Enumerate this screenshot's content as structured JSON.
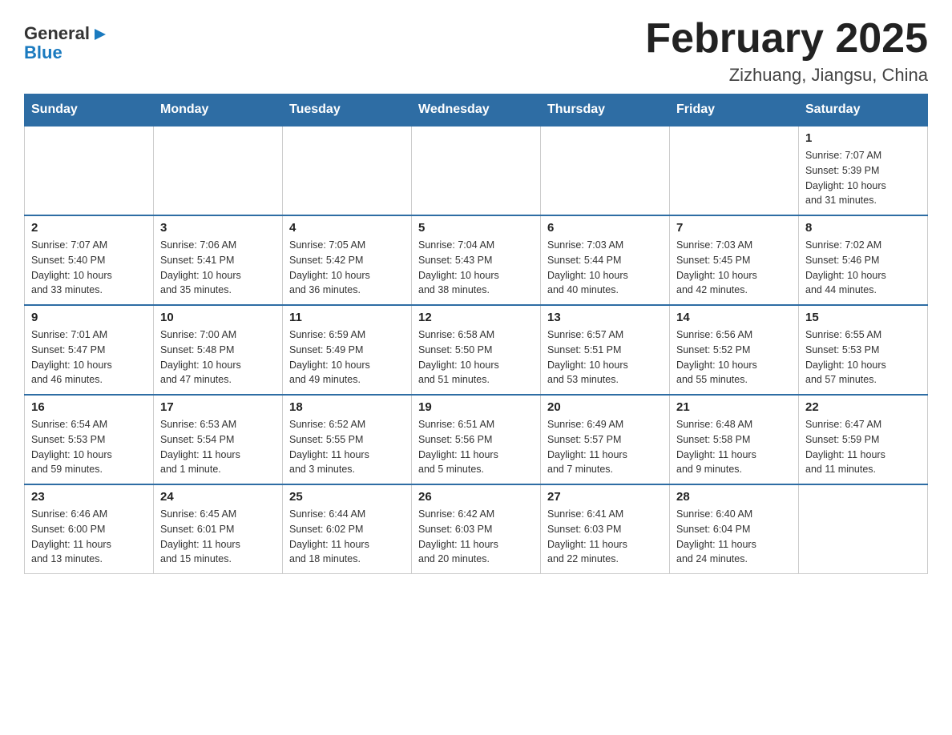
{
  "header": {
    "logo": {
      "text1": "General",
      "arrow": "▶",
      "text2": "Blue"
    },
    "title": "February 2025",
    "subtitle": "Zizhuang, Jiangsu, China"
  },
  "days_of_week": [
    "Sunday",
    "Monday",
    "Tuesday",
    "Wednesday",
    "Thursday",
    "Friday",
    "Saturday"
  ],
  "weeks": [
    {
      "days": [
        {
          "num": "",
          "info": ""
        },
        {
          "num": "",
          "info": ""
        },
        {
          "num": "",
          "info": ""
        },
        {
          "num": "",
          "info": ""
        },
        {
          "num": "",
          "info": ""
        },
        {
          "num": "",
          "info": ""
        },
        {
          "num": "1",
          "info": "Sunrise: 7:07 AM\nSunset: 5:39 PM\nDaylight: 10 hours\nand 31 minutes."
        }
      ]
    },
    {
      "days": [
        {
          "num": "2",
          "info": "Sunrise: 7:07 AM\nSunset: 5:40 PM\nDaylight: 10 hours\nand 33 minutes."
        },
        {
          "num": "3",
          "info": "Sunrise: 7:06 AM\nSunset: 5:41 PM\nDaylight: 10 hours\nand 35 minutes."
        },
        {
          "num": "4",
          "info": "Sunrise: 7:05 AM\nSunset: 5:42 PM\nDaylight: 10 hours\nand 36 minutes."
        },
        {
          "num": "5",
          "info": "Sunrise: 7:04 AM\nSunset: 5:43 PM\nDaylight: 10 hours\nand 38 minutes."
        },
        {
          "num": "6",
          "info": "Sunrise: 7:03 AM\nSunset: 5:44 PM\nDaylight: 10 hours\nand 40 minutes."
        },
        {
          "num": "7",
          "info": "Sunrise: 7:03 AM\nSunset: 5:45 PM\nDaylight: 10 hours\nand 42 minutes."
        },
        {
          "num": "8",
          "info": "Sunrise: 7:02 AM\nSunset: 5:46 PM\nDaylight: 10 hours\nand 44 minutes."
        }
      ]
    },
    {
      "days": [
        {
          "num": "9",
          "info": "Sunrise: 7:01 AM\nSunset: 5:47 PM\nDaylight: 10 hours\nand 46 minutes."
        },
        {
          "num": "10",
          "info": "Sunrise: 7:00 AM\nSunset: 5:48 PM\nDaylight: 10 hours\nand 47 minutes."
        },
        {
          "num": "11",
          "info": "Sunrise: 6:59 AM\nSunset: 5:49 PM\nDaylight: 10 hours\nand 49 minutes."
        },
        {
          "num": "12",
          "info": "Sunrise: 6:58 AM\nSunset: 5:50 PM\nDaylight: 10 hours\nand 51 minutes."
        },
        {
          "num": "13",
          "info": "Sunrise: 6:57 AM\nSunset: 5:51 PM\nDaylight: 10 hours\nand 53 minutes."
        },
        {
          "num": "14",
          "info": "Sunrise: 6:56 AM\nSunset: 5:52 PM\nDaylight: 10 hours\nand 55 minutes."
        },
        {
          "num": "15",
          "info": "Sunrise: 6:55 AM\nSunset: 5:53 PM\nDaylight: 10 hours\nand 57 minutes."
        }
      ]
    },
    {
      "days": [
        {
          "num": "16",
          "info": "Sunrise: 6:54 AM\nSunset: 5:53 PM\nDaylight: 10 hours\nand 59 minutes."
        },
        {
          "num": "17",
          "info": "Sunrise: 6:53 AM\nSunset: 5:54 PM\nDaylight: 11 hours\nand 1 minute."
        },
        {
          "num": "18",
          "info": "Sunrise: 6:52 AM\nSunset: 5:55 PM\nDaylight: 11 hours\nand 3 minutes."
        },
        {
          "num": "19",
          "info": "Sunrise: 6:51 AM\nSunset: 5:56 PM\nDaylight: 11 hours\nand 5 minutes."
        },
        {
          "num": "20",
          "info": "Sunrise: 6:49 AM\nSunset: 5:57 PM\nDaylight: 11 hours\nand 7 minutes."
        },
        {
          "num": "21",
          "info": "Sunrise: 6:48 AM\nSunset: 5:58 PM\nDaylight: 11 hours\nand 9 minutes."
        },
        {
          "num": "22",
          "info": "Sunrise: 6:47 AM\nSunset: 5:59 PM\nDaylight: 11 hours\nand 11 minutes."
        }
      ]
    },
    {
      "days": [
        {
          "num": "23",
          "info": "Sunrise: 6:46 AM\nSunset: 6:00 PM\nDaylight: 11 hours\nand 13 minutes."
        },
        {
          "num": "24",
          "info": "Sunrise: 6:45 AM\nSunset: 6:01 PM\nDaylight: 11 hours\nand 15 minutes."
        },
        {
          "num": "25",
          "info": "Sunrise: 6:44 AM\nSunset: 6:02 PM\nDaylight: 11 hours\nand 18 minutes."
        },
        {
          "num": "26",
          "info": "Sunrise: 6:42 AM\nSunset: 6:03 PM\nDaylight: 11 hours\nand 20 minutes."
        },
        {
          "num": "27",
          "info": "Sunrise: 6:41 AM\nSunset: 6:03 PM\nDaylight: 11 hours\nand 22 minutes."
        },
        {
          "num": "28",
          "info": "Sunrise: 6:40 AM\nSunset: 6:04 PM\nDaylight: 11 hours\nand 24 minutes."
        },
        {
          "num": "",
          "info": ""
        }
      ]
    }
  ]
}
